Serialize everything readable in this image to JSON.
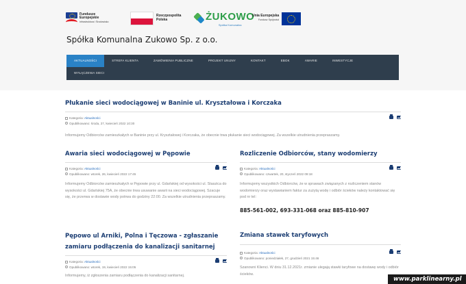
{
  "header": {
    "logos": [
      {
        "name": "Fundusze Europejskie",
        "line1": "Fundusze",
        "line2": "Europejskie",
        "sub": "Infrastruktura i Środowisko"
      },
      {
        "name": "Rzeczpospolita Polska",
        "line1": "Rzeczpospolita",
        "line2": "Polska"
      },
      {
        "name": "Żukowo",
        "word": "ŻUKOWO",
        "sub": "Spółka Komunalna"
      },
      {
        "name": "Unia Europejska",
        "line1": "Unia Europejska",
        "sub": "Fundusz Spójności"
      }
    ],
    "site_title": "Spółka Komunalna Zukowo Sp. z o.o.",
    "icons": {
      "eu_flag": "eu-flag-icon",
      "pl_flag": "poland-flag-icon"
    }
  },
  "nav": {
    "items": [
      {
        "label": "AKTUALNOŚCI",
        "active": true
      },
      {
        "label": "STREFA KLIENTA"
      },
      {
        "label": "ZAMÓWIENIA PUBLICZNE"
      },
      {
        "label": "PROJEKT UNIJNY"
      },
      {
        "label": "KONTAKT"
      },
      {
        "label": "EBOK"
      },
      {
        "label": "AWARIE"
      },
      {
        "label": "INWESTYCJE"
      },
      {
        "label": "WYŁĄCZENIA SIECI"
      }
    ]
  },
  "articles": {
    "featured": {
      "title": "Płukanie sieci wodociągowej w Baninie ul. Kryształowa i Korczaka",
      "category_label": "Kategoria:",
      "category": "Aktualności",
      "published": "Opublikowano: środa, 27, kwiecień 2022 10:30",
      "body": "Informujemy Odbiorców zamieszkałych w Baninie przy ul. Kryształowej i Korczaka, że obecnie trwa płukanie sieci wodociągowej. Za wszelkie utrudnienia przepraszamy."
    },
    "left1": {
      "title": "Awaria sieci wodociągowej w Pępowie",
      "category_label": "Kategoria:",
      "category": "Aktualności",
      "published": "Opublikowano: wtorek, 26, kwiecień 2022 17:45",
      "body": "Informujemy Odbiorców zamieszkałych w Pępowie przy ul. Gdańskiej od wysokości ul. Staszica do wysokości ul. Gdańskiej 75A, że obecnie trwa usuwanie awarii na sieci wodociągowej. Szacuje się, że przerwa w dostawie wody potrwa do godziny 22:00. Za wszelkie utrudnienia przepraszamy."
    },
    "right1": {
      "title": "Rozliczenie Odbiorców, stany wodomierzy",
      "category_label": "Kategoria:",
      "category": "Aktualności",
      "published": "Opublikowano: czwartek, 20, styczeń 2022 09:18",
      "body": "Informujemy wszystkich Odbiorców, że w sprawach związanych z rozliczeniem stanów wodomierzy oraz wystawianiem faktur za zużytą wodę i odbiór ścieków należy kontaktować się pod nr tel:",
      "phones": "885-561-002, 693-331-068 oraz 885-810-907"
    },
    "left2": {
      "title": "Pępowo ul Arniki, Polna i Tęczowa - zgłaszanie zamiaru podłączenia do kanalizacji sanitarnej",
      "category_label": "Kategoria:",
      "category": "Aktualności",
      "published": "Opublikowano: wtorek, 19, kwiecień 2022 15:05",
      "body": "Informujemy, iż zgłoszenia zamiaru podłączenia do kanalizacji sanitarnej."
    },
    "right2": {
      "title": "Zmiana stawek taryfowych",
      "category_label": "Kategoria:",
      "category": "Aktualności",
      "published": "Opublikowano: poniedziałek, 27, grudzień 2021 15:46",
      "body": "Szanowni Klienci. W dniu 31.12.2021r. zmianie ulegają stawki taryfowe na dostawę wody i odbiór ścieków."
    }
  },
  "tool_icons": {
    "print": "print-icon",
    "email": "email-icon"
  },
  "watermark": "www.parklinearny.pl"
}
